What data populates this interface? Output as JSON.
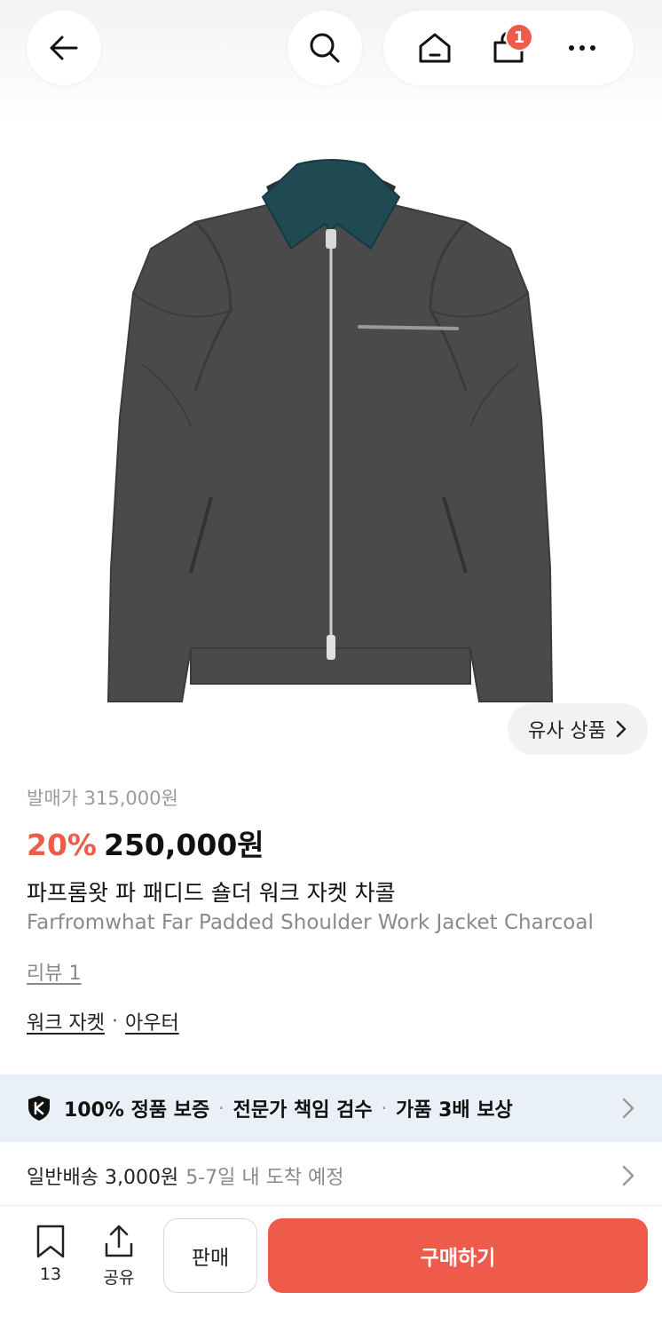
{
  "nav": {
    "cart_count": "1"
  },
  "gallery": {
    "similar_label": "유사 상품"
  },
  "product": {
    "release_price_label": "발매가 315,000원",
    "discount": "20%",
    "price": "250,000원",
    "title_kr": "파프롬왓 파 패디드 숄더 워크 자켓 차콜",
    "title_en": "Farfromwhat Far Padded Shoulder Work Jacket Charcoal",
    "review_link": "리뷰 1",
    "categories": [
      "워크 자켓",
      "아우터"
    ],
    "category_separator": "·"
  },
  "guarantee": {
    "items": [
      "100% 정품 보증",
      "전문가 책임 검수",
      "가품 3배 보상"
    ],
    "separator": "·"
  },
  "shipping": {
    "main": "일반배송 3,000원",
    "sub": "5-7일 내 도착 예정"
  },
  "actions": {
    "bookmark_count": "13",
    "share_label": "공유",
    "sell_label": "판매",
    "buy_label": "구매하기"
  },
  "colors": {
    "accent": "#ef5b4b",
    "guarantee_bg": "#eaf0f7",
    "muted_text": "#8a8a8a",
    "jacket_body": "#4a4a4a",
    "jacket_collar": "#1f4a52"
  },
  "icons": [
    "back-arrow-icon",
    "search-icon",
    "home-icon",
    "cart-icon",
    "more-icon",
    "chevron-right-icon",
    "shield-k-icon",
    "bookmark-icon",
    "share-icon"
  ]
}
